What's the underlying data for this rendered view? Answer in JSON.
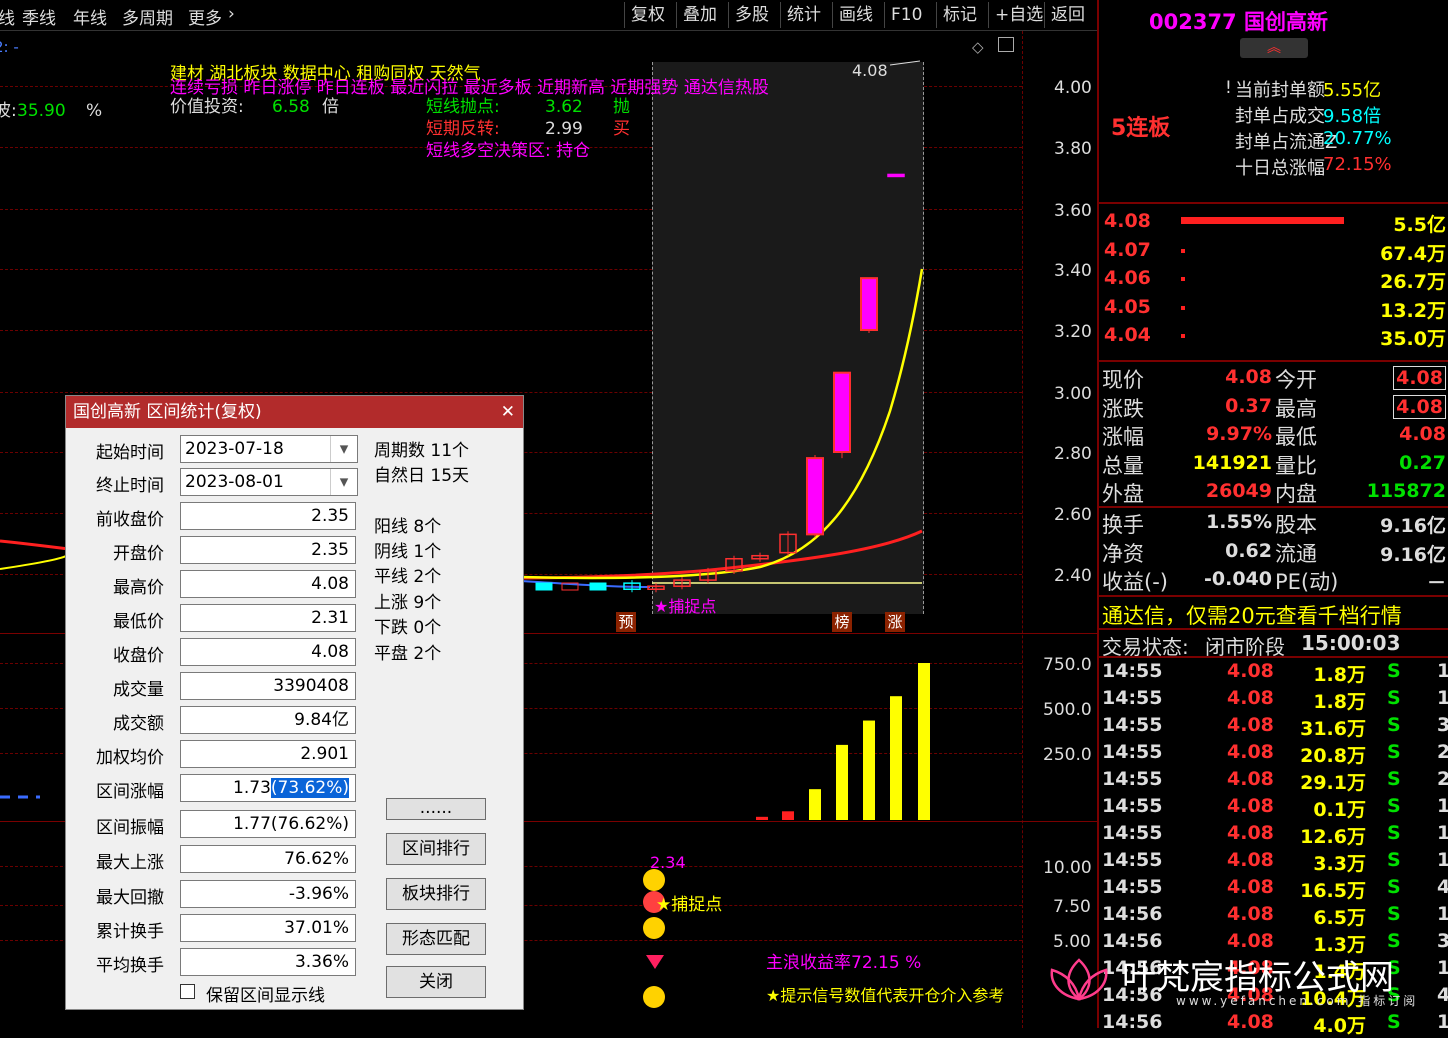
{
  "toolbar": {
    "left_items": [
      "线",
      "季线",
      "年线",
      "多周期",
      "更多"
    ],
    "more_arrow": "›",
    "right_buttons": [
      "复权",
      "叠加",
      "多股",
      "统计",
      "画线",
      "F10",
      "标记",
      "+自选",
      "返回"
    ]
  },
  "chart_header": {
    "top_left": "2: -",
    "pct_label": "波:",
    "pct_value": "35.90",
    "pct_unit": "%",
    "tags": "建材       湖北板块  数据中心 租购同权 天然气",
    "concepts": "连续亏损 昨日涨停 昨日连板 最近闪拉 最近多板 近期新高 近期强势 通达信热股",
    "value_label": "价值投资:",
    "value_num": "6.58",
    "value_unit": "倍",
    "sig1_label": "短线抛点:",
    "sig1_value": "3.62",
    "sig1_action": "抛",
    "sig2_label": "短期反转:",
    "sig2_value": "2.99",
    "sig2_action": "买",
    "sig3": "短线多空决策区: 持仓",
    "max_label": "4.08",
    "catch_point": "★捕捉点",
    "tag_yu": "预",
    "tag_bang": "榜",
    "tag_zhang": "涨"
  },
  "axis": {
    "price": [
      "4.00",
      "3.80",
      "3.60",
      "3.40",
      "3.20",
      "3.00",
      "2.80",
      "2.60",
      "2.40"
    ],
    "volume": [
      "750.0",
      "500.0",
      "250.0"
    ],
    "indicator": [
      "10.00",
      "7.50",
      "5.00"
    ]
  },
  "chart_data": {
    "type": "candlestick",
    "candles": [
      {
        "o": 2.37,
        "c": 2.35,
        "h": 2.38,
        "l": 2.34
      },
      {
        "o": 2.35,
        "c": 2.36,
        "h": 2.37,
        "l": 2.34
      },
      {
        "o": 2.36,
        "c": 2.38,
        "h": 2.39,
        "l": 2.35
      },
      {
        "o": 2.38,
        "c": 2.41,
        "h": 2.42,
        "l": 2.37
      },
      {
        "o": 2.41,
        "c": 2.45,
        "h": 2.46,
        "l": 2.4
      },
      {
        "o": 2.45,
        "c": 2.46,
        "h": 2.47,
        "l": 2.44
      },
      {
        "o": 2.47,
        "c": 2.53,
        "h": 2.54,
        "l": 2.46
      },
      {
        "o": 2.53,
        "c": 2.78,
        "h": 2.79,
        "l": 2.52
      },
      {
        "o": 2.8,
        "c": 3.06,
        "h": 3.06,
        "l": 2.78
      },
      {
        "o": 3.2,
        "c": 3.37,
        "h": 3.37,
        "l": 3.19
      },
      {
        "o": 3.71,
        "c": 3.71,
        "h": 3.71,
        "l": 3.71
      }
    ],
    "volume": [
      15,
      20,
      30,
      40,
      55,
      80,
      180,
      380,
      490,
      600,
      750
    ],
    "volume_colors": [
      "red",
      "red",
      "red",
      "red",
      "red",
      "red",
      "yellow",
      "yellow",
      "yellow",
      "yellow",
      "yellow"
    ]
  },
  "indicator": {
    "peak_value": "2.34",
    "catch_point": "★捕捉点",
    "wave_label": "主浪收益率72.15 %",
    "tip": "★提示信号数值代表开仓介入参考"
  },
  "dialog": {
    "title": "国创高新 区间统计(复权)",
    "close": "✕",
    "rows": [
      {
        "label": "起始时间",
        "value": "2023-07-18"
      },
      {
        "label": "终止时间",
        "value": "2023-08-01"
      },
      {
        "label": "前收盘价",
        "value": "2.35"
      },
      {
        "label": "开盘价",
        "value": "2.35"
      },
      {
        "label": "最高价",
        "value": "4.08"
      },
      {
        "label": "最低价",
        "value": "2.31"
      },
      {
        "label": "收盘价",
        "value": "4.08"
      },
      {
        "label": "成交量",
        "value": "3390408"
      },
      {
        "label": "成交额",
        "value": "9.84亿"
      },
      {
        "label": "加权均价",
        "value": "2.901"
      },
      {
        "label": "区间涨幅",
        "value": "1.73",
        "highlight": "(73.62%)"
      },
      {
        "label": "区间振幅",
        "value": "1.77(76.62%)"
      },
      {
        "label": "最大上涨",
        "value": "76.62%"
      },
      {
        "label": "最大回撤",
        "value": "-3.96%"
      },
      {
        "label": "累计换手",
        "value": "37.01%"
      },
      {
        "label": "平均换手",
        "value": "3.36%"
      }
    ],
    "stats": [
      "周期数 11个",
      "自然日 15天",
      "阳线 8个",
      "阴线 1个",
      "平线 2个",
      "上涨 9个",
      "下跌 0个",
      "平盘 2个"
    ],
    "buttons": [
      "......",
      "区间排行",
      "板块排行",
      "形态匹配",
      "关闭"
    ],
    "checkbox_label": "保留区间显示线"
  },
  "right_panel": {
    "code_name": "002377 国创高新",
    "streak": "5连板",
    "seal_info": [
      {
        "label": "当前封单额",
        "value": "5.55亿"
      },
      {
        "label": "封单占成交",
        "value": "9.58倍"
      },
      {
        "label": "封单占流通Z",
        "value": "20.77%"
      },
      {
        "label": "十日总涨幅",
        "value": "72.15%"
      }
    ],
    "order_book": [
      {
        "price": "4.08",
        "vol": "5.5亿"
      },
      {
        "price": "4.07",
        "vol": "67.4万"
      },
      {
        "price": "4.06",
        "vol": "26.7万"
      },
      {
        "price": "4.05",
        "vol": "13.2万"
      },
      {
        "price": "4.04",
        "vol": "35.0万"
      }
    ],
    "quote": [
      {
        "l1": "现价",
        "v1": "4.08",
        "l2": "今开",
        "v2": "4.08"
      },
      {
        "l1": "涨跌",
        "v1": "0.37",
        "l2": "最高",
        "v2": "4.08"
      },
      {
        "l1": "涨幅",
        "v1": "9.97%",
        "l2": "最低",
        "v2": "4.08"
      },
      {
        "l1": "总量",
        "v1": "141921",
        "l2": "量比",
        "v2": "0.27"
      },
      {
        "l1": "外盘",
        "v1": "26049",
        "l2": "内盘",
        "v2": "115872"
      }
    ],
    "fund": [
      {
        "l1": "换手",
        "v1": "1.55%",
        "l2": "股本",
        "v2": "9.16亿"
      },
      {
        "l1": "净资",
        "v1": "0.62",
        "l2": "流通",
        "v2": "9.16亿"
      },
      {
        "l1": "收益(-)",
        "v1": "-0.040",
        "l2": "PE(动)",
        "v2": "－"
      }
    ],
    "ad": "通达信，仅需20元查看千档行情",
    "trade_status_label": "交易状态:",
    "trade_status": "闭市阶段",
    "trade_time": "15:00:03",
    "ticks": [
      {
        "t": "14:55",
        "p": "4.08",
        "v": "1.8万",
        "s": "S",
        "n": "1"
      },
      {
        "t": "14:55",
        "p": "4.08",
        "v": "1.8万",
        "s": "S",
        "n": "1"
      },
      {
        "t": "14:55",
        "p": "4.08",
        "v": "31.6万",
        "s": "S",
        "n": "3"
      },
      {
        "t": "14:55",
        "p": "4.08",
        "v": "20.8万",
        "s": "S",
        "n": "2"
      },
      {
        "t": "14:55",
        "p": "4.08",
        "v": "29.1万",
        "s": "S",
        "n": "2"
      },
      {
        "t": "14:55",
        "p": "4.08",
        "v": "0.1万",
        "s": "S",
        "n": "1"
      },
      {
        "t": "14:55",
        "p": "4.08",
        "v": "12.6万",
        "s": "S",
        "n": "1"
      },
      {
        "t": "14:55",
        "p": "4.08",
        "v": "3.3万",
        "s": "S",
        "n": "1"
      },
      {
        "t": "14:55",
        "p": "4.08",
        "v": "16.5万",
        "s": "S",
        "n": "4"
      },
      {
        "t": "14:56",
        "p": "4.08",
        "v": "6.5万",
        "s": "S",
        "n": "1"
      },
      {
        "t": "14:56",
        "p": "4.08",
        "v": "1.3万",
        "s": "S",
        "n": "3"
      },
      {
        "t": "14:56",
        "p": "4.08",
        "v": "1.4万",
        "s": "S",
        "n": "1"
      },
      {
        "t": "14:56",
        "p": "4.08",
        "v": "10.4万",
        "s": "S",
        "n": "4"
      },
      {
        "t": "14:56",
        "p": "4.08",
        "v": "4.0万",
        "s": "S",
        "n": "1"
      }
    ]
  },
  "watermark": {
    "title": "叶梵宸指标公式网",
    "url": "www.yefanchen.com  指标订阅"
  }
}
